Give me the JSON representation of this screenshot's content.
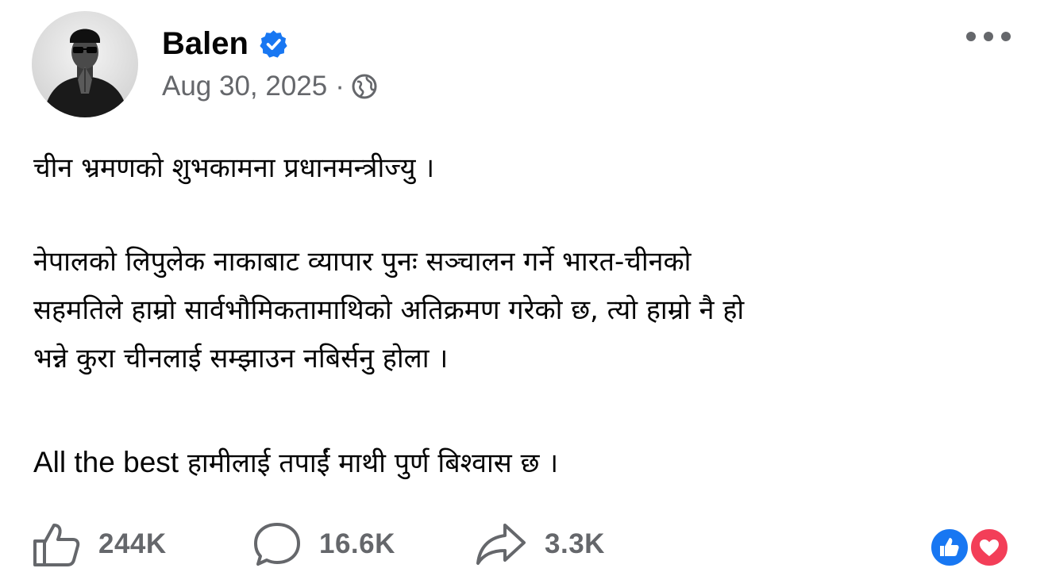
{
  "post": {
    "author": "Balen",
    "date": "Aug 30, 2025",
    "separator": "·",
    "verified": true,
    "paragraphs": {
      "p1": "चीन भ्रमणको शुभकामना प्रधानमन्त्रीज्यु ।",
      "p2_line1": "नेपालको लिपुलेक नाकाबाट व्यापार पुनः सञ्चालन गर्ने भारत-चीनको",
      "p2_line2": "सहमतिले हाम्रो सार्वभौमिकतामाथिको अतिक्रमण गरेको छ, त्यो हाम्रो नै हो",
      "p2_line3": "भन्ने कुरा चीनलाई सम्झाउन नबिर्सनु होला ।",
      "p3_latin": "All the best",
      "p3_rest": " हामीलाई तपाईं माथी पुर्ण बिश्वास छ ।"
    }
  },
  "actions": {
    "likes": "244K",
    "comments": "16.6K",
    "shares": "3.3K"
  },
  "icons": {
    "verified": "verified-badge-icon",
    "audience": "globe-icon",
    "more": "more-options-icon",
    "like": "thumbs-up-icon",
    "comment": "comment-bubble-icon",
    "share": "share-arrow-icon",
    "reaction_like": "like-reaction-icon",
    "reaction_love": "love-reaction-icon"
  },
  "colors": {
    "verified_blue": "#1877f2",
    "meta_gray": "#65676b",
    "love_red": "#f33e58"
  }
}
